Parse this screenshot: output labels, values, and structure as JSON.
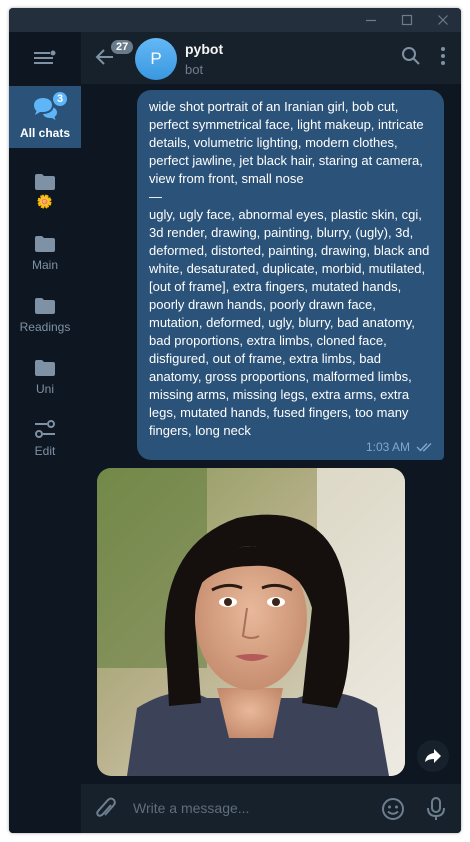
{
  "window": {
    "controls": [
      "minimize-icon",
      "maximize-icon",
      "close-icon"
    ]
  },
  "sidebar": {
    "menu_icon": "hamburger-menu-icon",
    "folders": [
      {
        "label": "All chats",
        "icon": "chats-icon",
        "badge": "3",
        "active": true
      },
      {
        "label": "🌼",
        "icon": "folder-icon"
      },
      {
        "label": "Main",
        "icon": "folder-icon"
      },
      {
        "label": "Readings",
        "icon": "folder-icon"
      },
      {
        "label": "Uni",
        "icon": "folder-icon"
      },
      {
        "label": "Edit",
        "icon": "settings-sliders-icon"
      }
    ]
  },
  "header": {
    "back_badge": "27",
    "avatar_letter": "P",
    "chat_name": "pybot",
    "chat_status": "bot",
    "icons": [
      "search-icon",
      "more-vertical-icon"
    ]
  },
  "messages": [
    {
      "type": "outgoing-text",
      "text": "wide shot portrait of an Iranian girl, bob cut, perfect symmetrical face, light makeup, intricate details, volumetric lighting, modern clothes, perfect jawline, jet black hair, staring at camera, view from front, small nose\n—\nugly, ugly face, abnormal eyes, plastic skin, cgi, 3d render, drawing, painting, blurry, (ugly), 3d, deformed, distorted, painting, drawing, black and white, desaturated, duplicate, morbid, mutilated, [out of frame], extra fingers, mutated hands, poorly drawn hands, poorly drawn face, mutation, deformed, ugly, blurry, bad anatomy, bad proportions, extra limbs, cloned face, disfigured, out of frame, extra limbs, bad anatomy, gross proportions, malformed limbs, missing arms, missing legs, extra arms, extra legs, mutated hands, fused fingers, too many fingers, long neck",
      "time": "1:03 AM",
      "status": "read"
    },
    {
      "type": "incoming-photo",
      "content": "portrait photo of a woman with a black bob haircut"
    }
  ],
  "composer": {
    "placeholder": "Write a message..."
  },
  "colors": {
    "accent": "#5eb5f7",
    "bubble_out": "#2b5278",
    "background": "#0e1621",
    "panel": "#17212b"
  }
}
